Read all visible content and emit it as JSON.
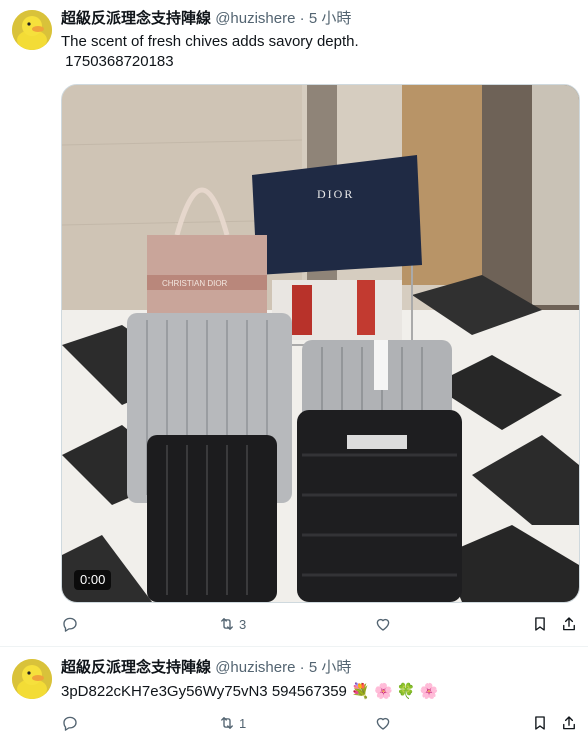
{
  "tweets": [
    {
      "display_name": "超級反派理念支持陣線",
      "handle": "@huzishere",
      "separator": "·",
      "time": "5 小時",
      "text_line1": "The scent of fresh chives adds savory depth.",
      "text_line2": " 1750368720183",
      "media": {
        "duration": "0:00",
        "bag_brand": "DIOR",
        "tote_text": "CHRISTIAN DIOR"
      },
      "reply_count": "",
      "retweet_count": "3",
      "like_count": ""
    },
    {
      "display_name": "超級反派理念支持陣線",
      "handle": "@huzishere",
      "separator": "·",
      "time": "5 小時",
      "text": "3pD822cKH7e3Gy56Wy75vN3 594567359",
      "emojis": [
        "💐",
        "🌸",
        "🍀",
        "🌸"
      ],
      "reply_count": "",
      "retweet_count": "1",
      "like_count": ""
    }
  ],
  "icons": {
    "avatar": "yellow-duck-avatar",
    "reply": "reply-icon",
    "retweet": "retweet-icon",
    "like": "heart-icon",
    "bookmark": "bookmark-icon",
    "share": "share-icon"
  },
  "colors": {
    "text": "#0f1419",
    "muted": "#536471",
    "divider": "#eff3f4"
  }
}
